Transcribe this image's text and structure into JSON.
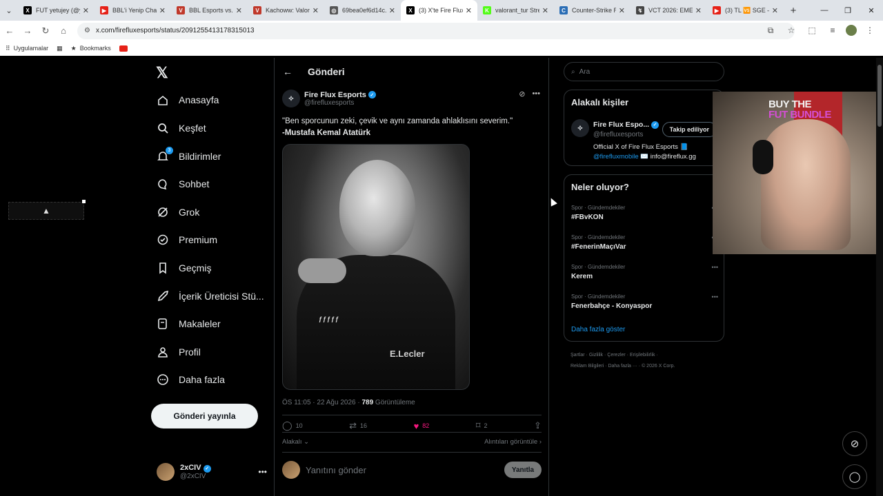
{
  "browser": {
    "tabs": [
      {
        "title": "FUT yetujey (@yet",
        "fav_color": "#000000",
        "fav_glyph": "X"
      },
      {
        "title": "BBL'i Yenip Cham",
        "fav_color": "#e62117",
        "fav_glyph": "▶"
      },
      {
        "title": "BBL Esports vs. Fu",
        "fav_color": "#c0392b",
        "fav_glyph": "V"
      },
      {
        "title": "Kachoww: Valorant",
        "fav_color": "#c0392b",
        "fav_glyph": "V"
      },
      {
        "title": "69bea0ef6d14c.pn",
        "fav_color": "#555555",
        "fav_glyph": "◎"
      },
      {
        "title": "(3) X'te Fire Flux E",
        "fav_color": "#000000",
        "fav_glyph": "X"
      },
      {
        "title": "valorant_tur Strea",
        "fav_color": "#53fc18",
        "fav_glyph": "K"
      },
      {
        "title": "Counter-Strike Ra",
        "fav_color": "#2a6db5",
        "fav_glyph": "C"
      },
      {
        "title": "VCT 2026: EMEA",
        "fav_color": "#444444",
        "fav_glyph": "↯"
      },
      {
        "title": "(3) TL 🆚 SGE —",
        "fav_color": "#e62117",
        "fav_glyph": "▶"
      }
    ],
    "active_tab_index": 5,
    "url": "x.com/firefluxesports/status/2091255413178315013",
    "bookmarks": {
      "apps_label": "Uygulamalar",
      "bookmarks_label": "Bookmarks"
    }
  },
  "nav": {
    "items": [
      {
        "label": "Anasayfa",
        "icon": "home-icon"
      },
      {
        "label": "Keşfet",
        "icon": "search-icon"
      },
      {
        "label": "Bildirimler",
        "icon": "bell-icon",
        "badge": "3"
      },
      {
        "label": "Sohbet",
        "icon": "chat-icon"
      },
      {
        "label": "Grok",
        "icon": "grok-icon"
      },
      {
        "label": "Premium",
        "icon": "premium-icon"
      },
      {
        "label": "Geçmiş",
        "icon": "bookmark-icon"
      },
      {
        "label": "İçerik Üreticisi Stü...",
        "icon": "rocket-icon"
      },
      {
        "label": "Makaleler",
        "icon": "article-icon"
      },
      {
        "label": "Profil",
        "icon": "person-icon"
      },
      {
        "label": "Daha fazla",
        "icon": "more-circle-icon"
      }
    ],
    "post_button": "Gönderi yayınla",
    "me": {
      "name": "2xCIV",
      "handle": "@2xCIV"
    }
  },
  "post": {
    "header_title": "Gönderi",
    "author_name": "Fire Flux Esports",
    "author_handle": "@firefluxesports",
    "text_line1": "\"Ben sporcunun zeki, çevik ve aynı zamanda ahlaklısını severim.\"",
    "text_line2": "-Mustafa Kemal Atatürk",
    "photo_logo1": "ƒƒƒƒƒ",
    "photo_logo2": "E.Lecler",
    "time": "ÖS 11:05 · 22 Ağu 2026 · ",
    "views_count": "789",
    "views_label": " Görüntüleme",
    "stats": {
      "replies": "10",
      "reposts": "16",
      "likes": "82",
      "bookmarks": "2"
    },
    "related_label": "Alakalı",
    "quotes_label": "Alıntıları görüntüle",
    "reply_placeholder": "Yanıtını gönder",
    "reply_button": "Yanıtla"
  },
  "sidebar": {
    "search_placeholder": "Ara",
    "related_title": "Alakalı kişiler",
    "related_person": {
      "name": "Fire Flux Espo...",
      "handle": "@firefluxesports",
      "follow_label": "Takip ediliyor",
      "bio_line1": "Official X of Fire Flux Esports 📘",
      "bio_link": "@firefluxmobile",
      "bio_rest": " ✉️ info@fireflux.gg"
    },
    "trends_title": "Neler oluyor?",
    "trends": [
      {
        "category": "Spor · Gündemdekiler",
        "title": "#FBvKON"
      },
      {
        "category": "Spor · Gündemdekiler",
        "title": "#FenerinMaçıVar"
      },
      {
        "category": "Spor · Gündemdekiler",
        "title": "Kerem"
      },
      {
        "category": "Spor · Gündemdekiler",
        "title": "Fenerbahçe - Konyaspor"
      }
    ],
    "show_more": "Daha fazla göster",
    "footer_line1": "Şartlar  ·  Gizlilik  ·  Çerezler  ·  Erişilebilirlik  ·",
    "footer_line2": "Reklam Bilgileri  ·  Daha fazla ···  ·  © 2026 X Corp."
  },
  "overlay": {
    "cam_label_line1": "BUY THE",
    "cam_label_line2": "FUT BUNDLE",
    "chip_text": "▲"
  }
}
